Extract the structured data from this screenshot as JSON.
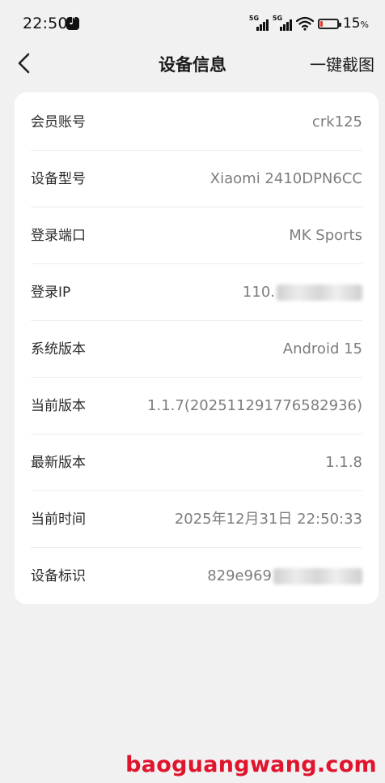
{
  "status_bar": {
    "time": "22:50",
    "network_1": "5G",
    "network_2": "5G",
    "battery_percent": "15",
    "battery_level": 0.15,
    "battery_color": "#e53935",
    "app_icon": "tiktok-icon"
  },
  "nav": {
    "back_icon": "chevron-left-icon",
    "title": "设备信息",
    "action_label": "一键截图"
  },
  "rows": [
    {
      "label": "会员账号",
      "value": "crk125"
    },
    {
      "label": "设备型号",
      "value": "Xiaomi  2410DPN6CC"
    },
    {
      "label": "登录端口",
      "value": "MK Sports"
    },
    {
      "label": "登录IP",
      "value": "110."
    },
    {
      "label": "系统版本",
      "value": "Android 15"
    },
    {
      "label": "当前版本",
      "value": "1.1.7(202511291776582936)"
    },
    {
      "label": "最新版本",
      "value": "1.1.8"
    },
    {
      "label": "当前时间",
      "value": "2025年12月31日 22:50:33"
    },
    {
      "label": "设备标识",
      "value": "829e969"
    }
  ],
  "watermark": "baoguangwang.com"
}
